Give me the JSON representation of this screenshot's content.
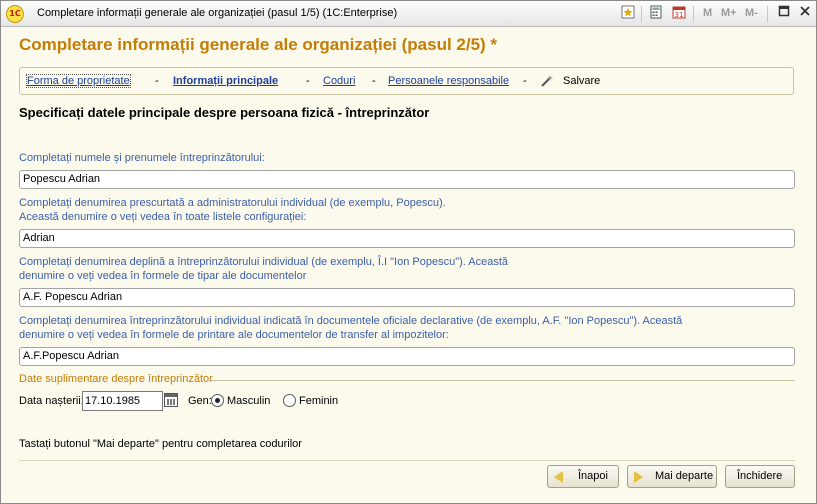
{
  "window": {
    "title": "Completare informații generale ale organizației (pasul 1/5)  (1C:Enterprise)",
    "logo_text": "1C",
    "toolbar": {
      "m_label": "M",
      "m_plus_label": "M+",
      "m_minus_label": "M-",
      "minimize": "_",
      "maximize": "□",
      "close": "✕"
    }
  },
  "header": {
    "title": "Completare informații generale ale organizației (pasul 2/5) *"
  },
  "steps": {
    "items": [
      {
        "label": "Forma de proprietate"
      },
      {
        "label": "Informații principale"
      },
      {
        "label": "Coduri"
      },
      {
        "label": "Persoanele responsabile"
      },
      {
        "label": "Salvare"
      }
    ],
    "separator": "-"
  },
  "form": {
    "subtitle": "Specificați datele principale despre persoana fizică - întreprinzător",
    "name_label": "Completați numele și prenumele întreprinzătorului:",
    "name_value": "Popescu Adrian",
    "short_label": "Completați denumirea prescurtată a administratorului individual (de exemplu, Popescu). Această denumire o veți vedea în toate listele configurației:",
    "short_value": "Adrian",
    "full_label": "Completați denumirea deplină a întreprinzătorului individual (de exemplu, Î.I \"Ion Popescu\"). Această denumire o veți vedea în formele de tipar ale documentelor",
    "full_value": "A.F. Popescu Adrian",
    "official_label": "Completați denumirea întreprinzătorului individual indicată în documentele oficiale declarative (de exemplu, A.F. \"Ion Popescu\"). Această denumire o veți vedea în formele de printare ale documentelor de transfer al impozitelor:",
    "official_value": "A.F.Popescu Adrian",
    "group_title": "Date suplimentare despre întreprinzător",
    "birth_label": "Data nașterii:",
    "birth_value": "17.10.1985",
    "gender_label": "Gen:",
    "gender_male": "Masculin",
    "gender_female": "Feminin",
    "gender_selected": "Masculin",
    "hint": "Tastați butonul \"Mai departe\" pentru completarea codurilor"
  },
  "buttons": {
    "back": "Înapoi",
    "next": "Mai departe",
    "close": "Închidere"
  },
  "colors": {
    "accent": "#c47d05",
    "link": "#1f3f96",
    "label": "#3c5fa8",
    "background": "#fbfaed"
  }
}
